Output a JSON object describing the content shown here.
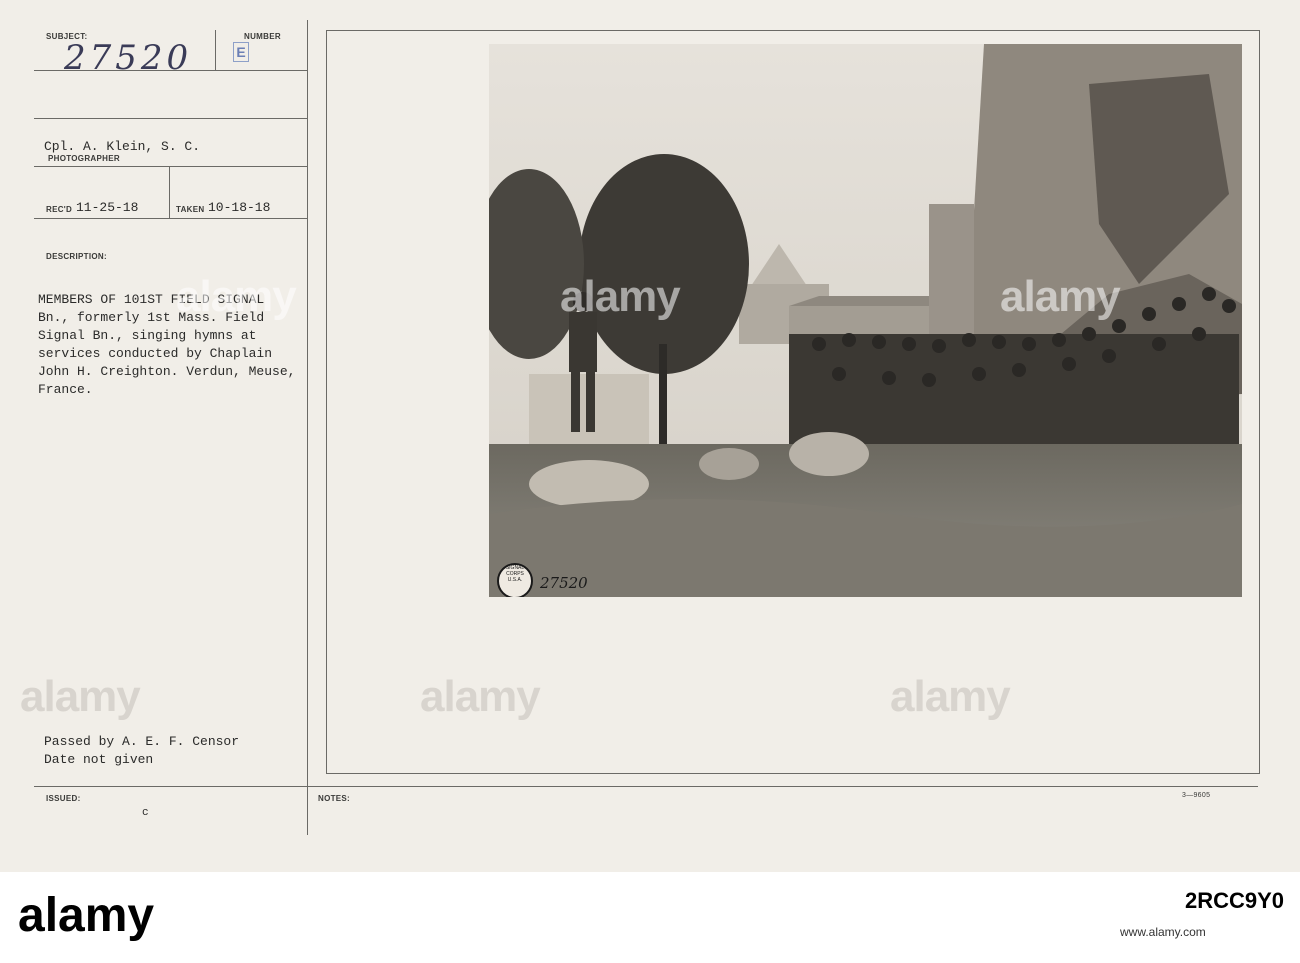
{
  "card": {
    "subject_label": "SUBJECT:",
    "subject_value": "27520",
    "number_label": "NUMBER",
    "number_value": "E",
    "photographer_value": "Cpl. A. Klein, S. C.",
    "photographer_label": "PHOTOGRAPHER",
    "recd_label": "REC'D",
    "recd_value": "11-25-18",
    "taken_label": "TAKEN",
    "taken_value": "10-18-18",
    "description_label": "DESCRIPTION:",
    "description_lines": [
      "MEMBERS OF 101ST FIELD SIGNAL",
      "Bn., formerly 1st Mass. Field",
      "Signal Bn., singing hymns at",
      "services conducted by Chaplain",
      "John H. Creighton. Verdun, Meuse,",
      "France."
    ],
    "censor_lines": [
      "Passed by A. E. F. Censor",
      "Date not given"
    ],
    "issued_label": "ISSUED:",
    "issued_mark": "c",
    "notes_label": "NOTES:",
    "form_code": "3—9605"
  },
  "photo": {
    "overlay_number": "27520",
    "seal_text": "SIGNAL CORPS U.S.A."
  },
  "watermark": "alamy",
  "footer": {
    "logo": "alamy",
    "image_id": "2RCC9Y0",
    "site": "www.alamy.com"
  }
}
